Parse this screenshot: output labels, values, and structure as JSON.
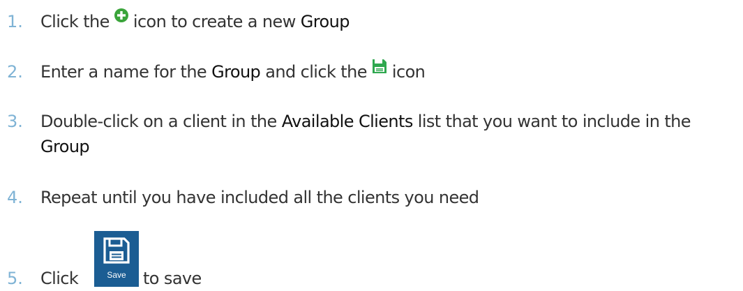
{
  "steps": [
    {
      "number": "1.",
      "before": "Click the ",
      "after": " icon to create a new ",
      "keyword": "Group"
    },
    {
      "number": "2.",
      "before": "Enter a name for the ",
      "keyword": "Group",
      "middle": " and click the ",
      "after": " icon"
    },
    {
      "number": "3.",
      "before": "Double-click on a client in the ",
      "keyword": "Available Clients",
      "middle": " list that you want to include in the ",
      "keyword2": "Group"
    },
    {
      "number": "4.",
      "text": "Repeat until you have included all the clients you need"
    },
    {
      "number": "5.",
      "before": "Click",
      "button_label": "Save",
      "after": "to save"
    }
  ],
  "colors": {
    "step_number": "#7fb3d5",
    "body_text": "#333333",
    "keyword_text": "#111111",
    "add_icon": "#3aa43a",
    "save_icon": "#2fa84f",
    "save_button_bg": "#1b5d93"
  },
  "icons": {
    "add": "plus-circle-icon",
    "save_inline": "floppy-disk-icon",
    "save_button": "floppy-disk-icon"
  }
}
